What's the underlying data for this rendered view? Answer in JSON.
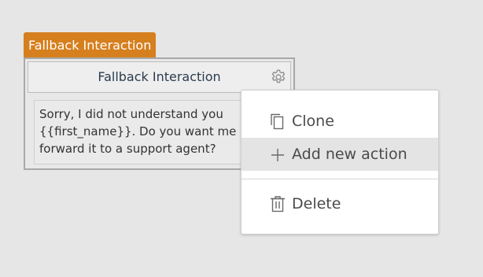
{
  "node": {
    "tag_label": "Fallback Interaction",
    "title": "Fallback Interaction",
    "message_lines": [
      "Sorry, I did not understand you",
      "{{first_name}}. Do you want me",
      "forward it to a support agent?"
    ],
    "settings_icon": "gear-icon"
  },
  "context_menu": {
    "items": [
      {
        "label": "Clone",
        "icon": "copy-icon",
        "highlighted": false
      },
      {
        "label": "Add new action",
        "icon": "plus-icon",
        "highlighted": true
      },
      {
        "label": "Delete",
        "icon": "trash-icon",
        "highlighted": false
      }
    ]
  },
  "colors": {
    "tag_background": "#d67f1e",
    "canvas_background": "#e6e6e6",
    "menu_highlight": "#e4e4e4",
    "title_text": "#2b3c4e"
  }
}
